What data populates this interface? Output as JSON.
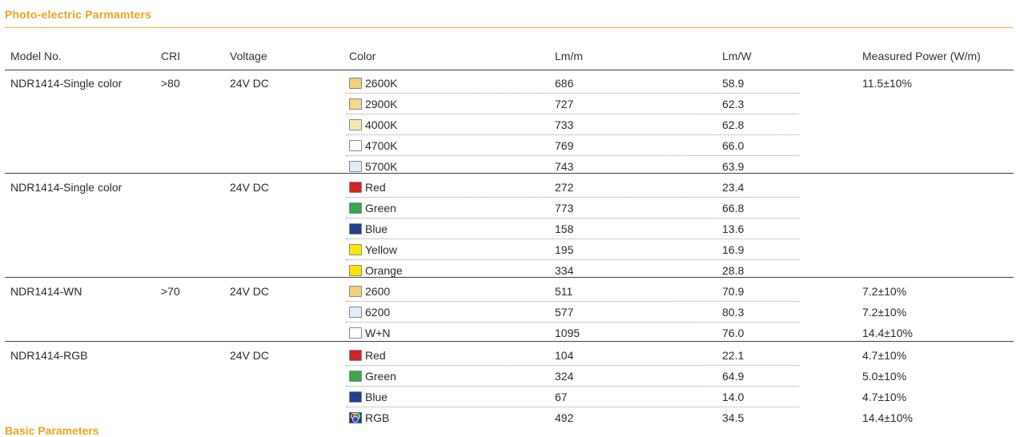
{
  "section_title": "Photo-electric Parmamters",
  "next_section_title": "Basic Parameters",
  "colors": {
    "accent": "#f0a21c"
  },
  "headers": {
    "model": "Model No.",
    "cri": "CRI",
    "voltage": "Voltage",
    "color": "Color",
    "lm_m": "Lm/m",
    "lm_w": "Lm/W",
    "power": "Measured Power (W/m)"
  },
  "groups": [
    {
      "model": "NDR1414-Single color",
      "cri": ">80",
      "voltage": "24V DC",
      "power": "11.5±10%",
      "rows": [
        {
          "color_name": "2600K",
          "swatch": "#f1d27a",
          "lm_m": "686",
          "lm_w": "58.9"
        },
        {
          "color_name": "2900K",
          "swatch": "#f4d98f",
          "lm_m": "727",
          "lm_w": "62.3"
        },
        {
          "color_name": "4000K",
          "swatch": "#f6e8b6",
          "lm_m": "733",
          "lm_w": "62.8"
        },
        {
          "color_name": "4700K",
          "swatch": "#ffffff",
          "lm_m": "769",
          "lm_w": "66.0"
        },
        {
          "color_name": "5700K",
          "swatch": "#ddeef8",
          "lm_m": "743",
          "lm_w": "63.9"
        }
      ]
    },
    {
      "model": "NDR1414-Single color",
      "cri": "",
      "voltage": "24V DC",
      "power": "",
      "rows": [
        {
          "color_name": "Red",
          "swatch": "#d3222a",
          "lm_m": "272",
          "lm_w": "23.4"
        },
        {
          "color_name": "Green",
          "swatch": "#3aa64a",
          "lm_m": "773",
          "lm_w": "66.8"
        },
        {
          "color_name": "Blue",
          "swatch": "#233f8f",
          "lm_m": "158",
          "lm_w": "13.6"
        },
        {
          "color_name": "Yellow",
          "swatch": "#ffe800",
          "lm_m": "195",
          "lm_w": "16.9"
        },
        {
          "color_name": "Orange",
          "swatch": "#ffe200",
          "lm_m": "334",
          "lm_w": "28.8"
        }
      ]
    },
    {
      "model": "NDR1414-WN",
      "cri": ">70",
      "voltage": "24V DC",
      "power": "",
      "rows": [
        {
          "color_name": "2600",
          "swatch": "#f1d27a",
          "lm_m": "511",
          "lm_w": "70.9",
          "power": "7.2±10%"
        },
        {
          "color_name": "6200",
          "swatch": "#ddeef8",
          "lm_m": "577",
          "lm_w": "80.3",
          "power": "7.2±10%"
        },
        {
          "color_name": "W+N",
          "swatch": "#ffffff",
          "lm_m": "1095",
          "lm_w": "76.0",
          "power": "14.4±10%"
        }
      ]
    },
    {
      "model": "NDR1414-RGB",
      "cri": "",
      "voltage": "24V DC",
      "power": "",
      "rows": [
        {
          "color_name": "Red",
          "swatch": "#d3222a",
          "lm_m": "104",
          "lm_w": "22.1",
          "power": "4.7±10%"
        },
        {
          "color_name": "Green",
          "swatch": "#3aa64a",
          "lm_m": "324",
          "lm_w": "64.9",
          "power": "5.0±10%"
        },
        {
          "color_name": "Blue",
          "swatch": "#233f8f",
          "lm_m": "67",
          "lm_w": "14.0",
          "power": "4.7±10%"
        },
        {
          "color_name": "RGB",
          "swatch": "rgb-icon",
          "lm_m": "492",
          "lm_w": "34.5",
          "power": "14.4±10%"
        }
      ]
    }
  ]
}
